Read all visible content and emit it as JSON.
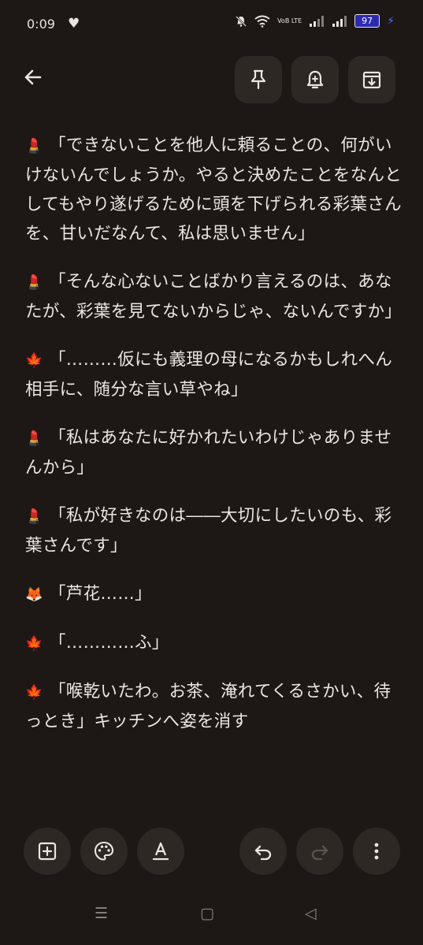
{
  "status": {
    "time": "0:09",
    "volte": "VoB LTE",
    "battery": "97"
  },
  "icons": {
    "back": "arrow-left-icon",
    "pin": "pin-icon",
    "reminder": "bell-plus-icon",
    "archive": "archive-icon",
    "add": "plus-box-icon",
    "palette": "palette-icon",
    "text_format": "text-format-icon",
    "undo": "undo-icon",
    "redo": "redo-icon",
    "more": "more-vert-icon"
  },
  "colors": {
    "background": "#1d1815",
    "button": "#2e2825",
    "text": "#ece6e2",
    "battery": "#2c2bb0"
  },
  "note": {
    "paragraphs": [
      {
        "emoji": "💄",
        "text": "「できないことを他人に頼ることの、何がいけないんでしょうか。やると決めたことをなんとしてもやり遂げるために頭を下げられる彩葉さんを、甘いだなんて、私は思いません」"
      },
      {
        "emoji": "💄",
        "text": "「そんな心ないことばかり言えるのは、あなたが、彩葉を見てないからじゃ、ないんですか」"
      },
      {
        "emoji": "🍁",
        "text": "「………仮にも義理の母になるかもしれへん相手に、随分な言い草やね」"
      },
      {
        "emoji": "💄",
        "text": "「私はあなたに好かれたいわけじゃありませんから」"
      },
      {
        "emoji": "💄",
        "text": "「私が好きなのは――大切にしたいのも、彩葉さんです」"
      },
      {
        "emoji": "🦊",
        "text": "「芦花……」"
      },
      {
        "emoji": "🍁",
        "text": "「…………ふ」"
      },
      {
        "emoji": "🍁",
        "text": "「喉乾いたわ。お茶、淹れてくるさかい、待っとき」キッチンへ姿を消す"
      }
    ]
  },
  "nav": {
    "recents": "☰",
    "home": "▢",
    "back": "◁"
  }
}
